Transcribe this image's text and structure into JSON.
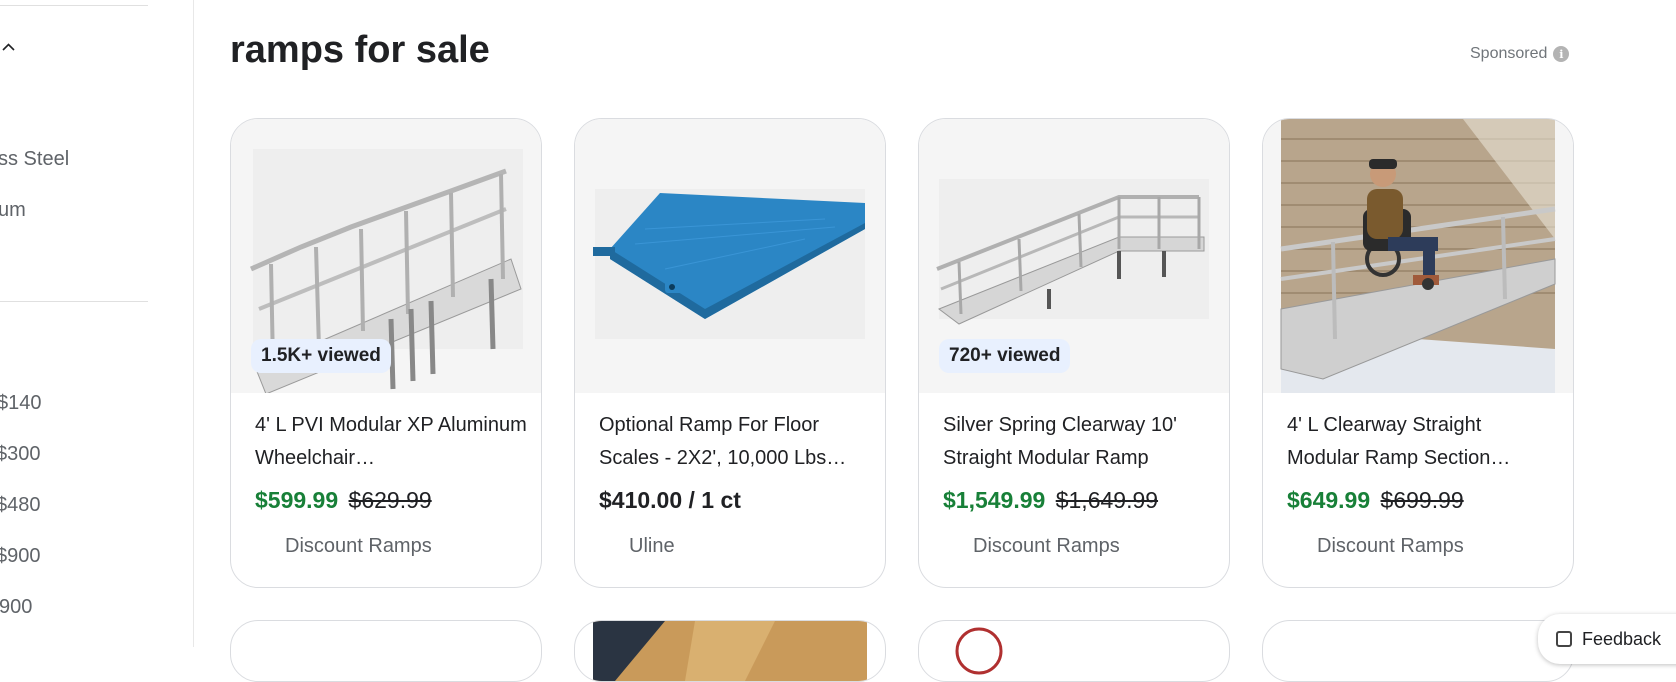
{
  "sidebar": {
    "items": [
      {
        "label": "ss Steel"
      },
      {
        "label": "um"
      },
      {
        "label": "$140"
      },
      {
        "label": " $300"
      },
      {
        "label": " $480"
      },
      {
        "label": " $900"
      },
      {
        "label": "900"
      }
    ]
  },
  "main": {
    "title": "ramps for sale",
    "sponsored_label": "Sponsored",
    "info_glyph": "i",
    "products": [
      {
        "badge": "1.5K+ viewed",
        "title": "4' L PVI Modular XP Aluminum Wheelchair…",
        "price": "$599.99",
        "old_price": "$629.99",
        "seller": "Discount Ramps",
        "image": "aluminum-ramp-with-rails"
      },
      {
        "badge": "",
        "title": "Optional Ramp For Floor Scales - 2X2', 10,000 Lbs…",
        "price": "$410.00 / 1 ct",
        "old_price": "",
        "seller": "Uline",
        "image": "blue-steel-ramp"
      },
      {
        "badge": "720+ viewed",
        "title": "Silver Spring Clearway 10' Straight Modular Ramp",
        "price": "$1,549.99",
        "old_price": "$1,649.99",
        "seller": "Discount Ramps",
        "image": "modular-ramp-with-platform"
      },
      {
        "badge": "",
        "title": "4' L Clearway Straight Modular Ramp Section…",
        "price": "$649.99",
        "old_price": "$699.99",
        "seller": "Discount Ramps",
        "image": "man-in-wheelchair-on-ramp"
      }
    ]
  },
  "feedback": {
    "label": "Feedback"
  },
  "colors": {
    "sale_price": "#188038",
    "badge_bg": "#e8f0fe",
    "ramp_blue": "#2b86c5"
  }
}
